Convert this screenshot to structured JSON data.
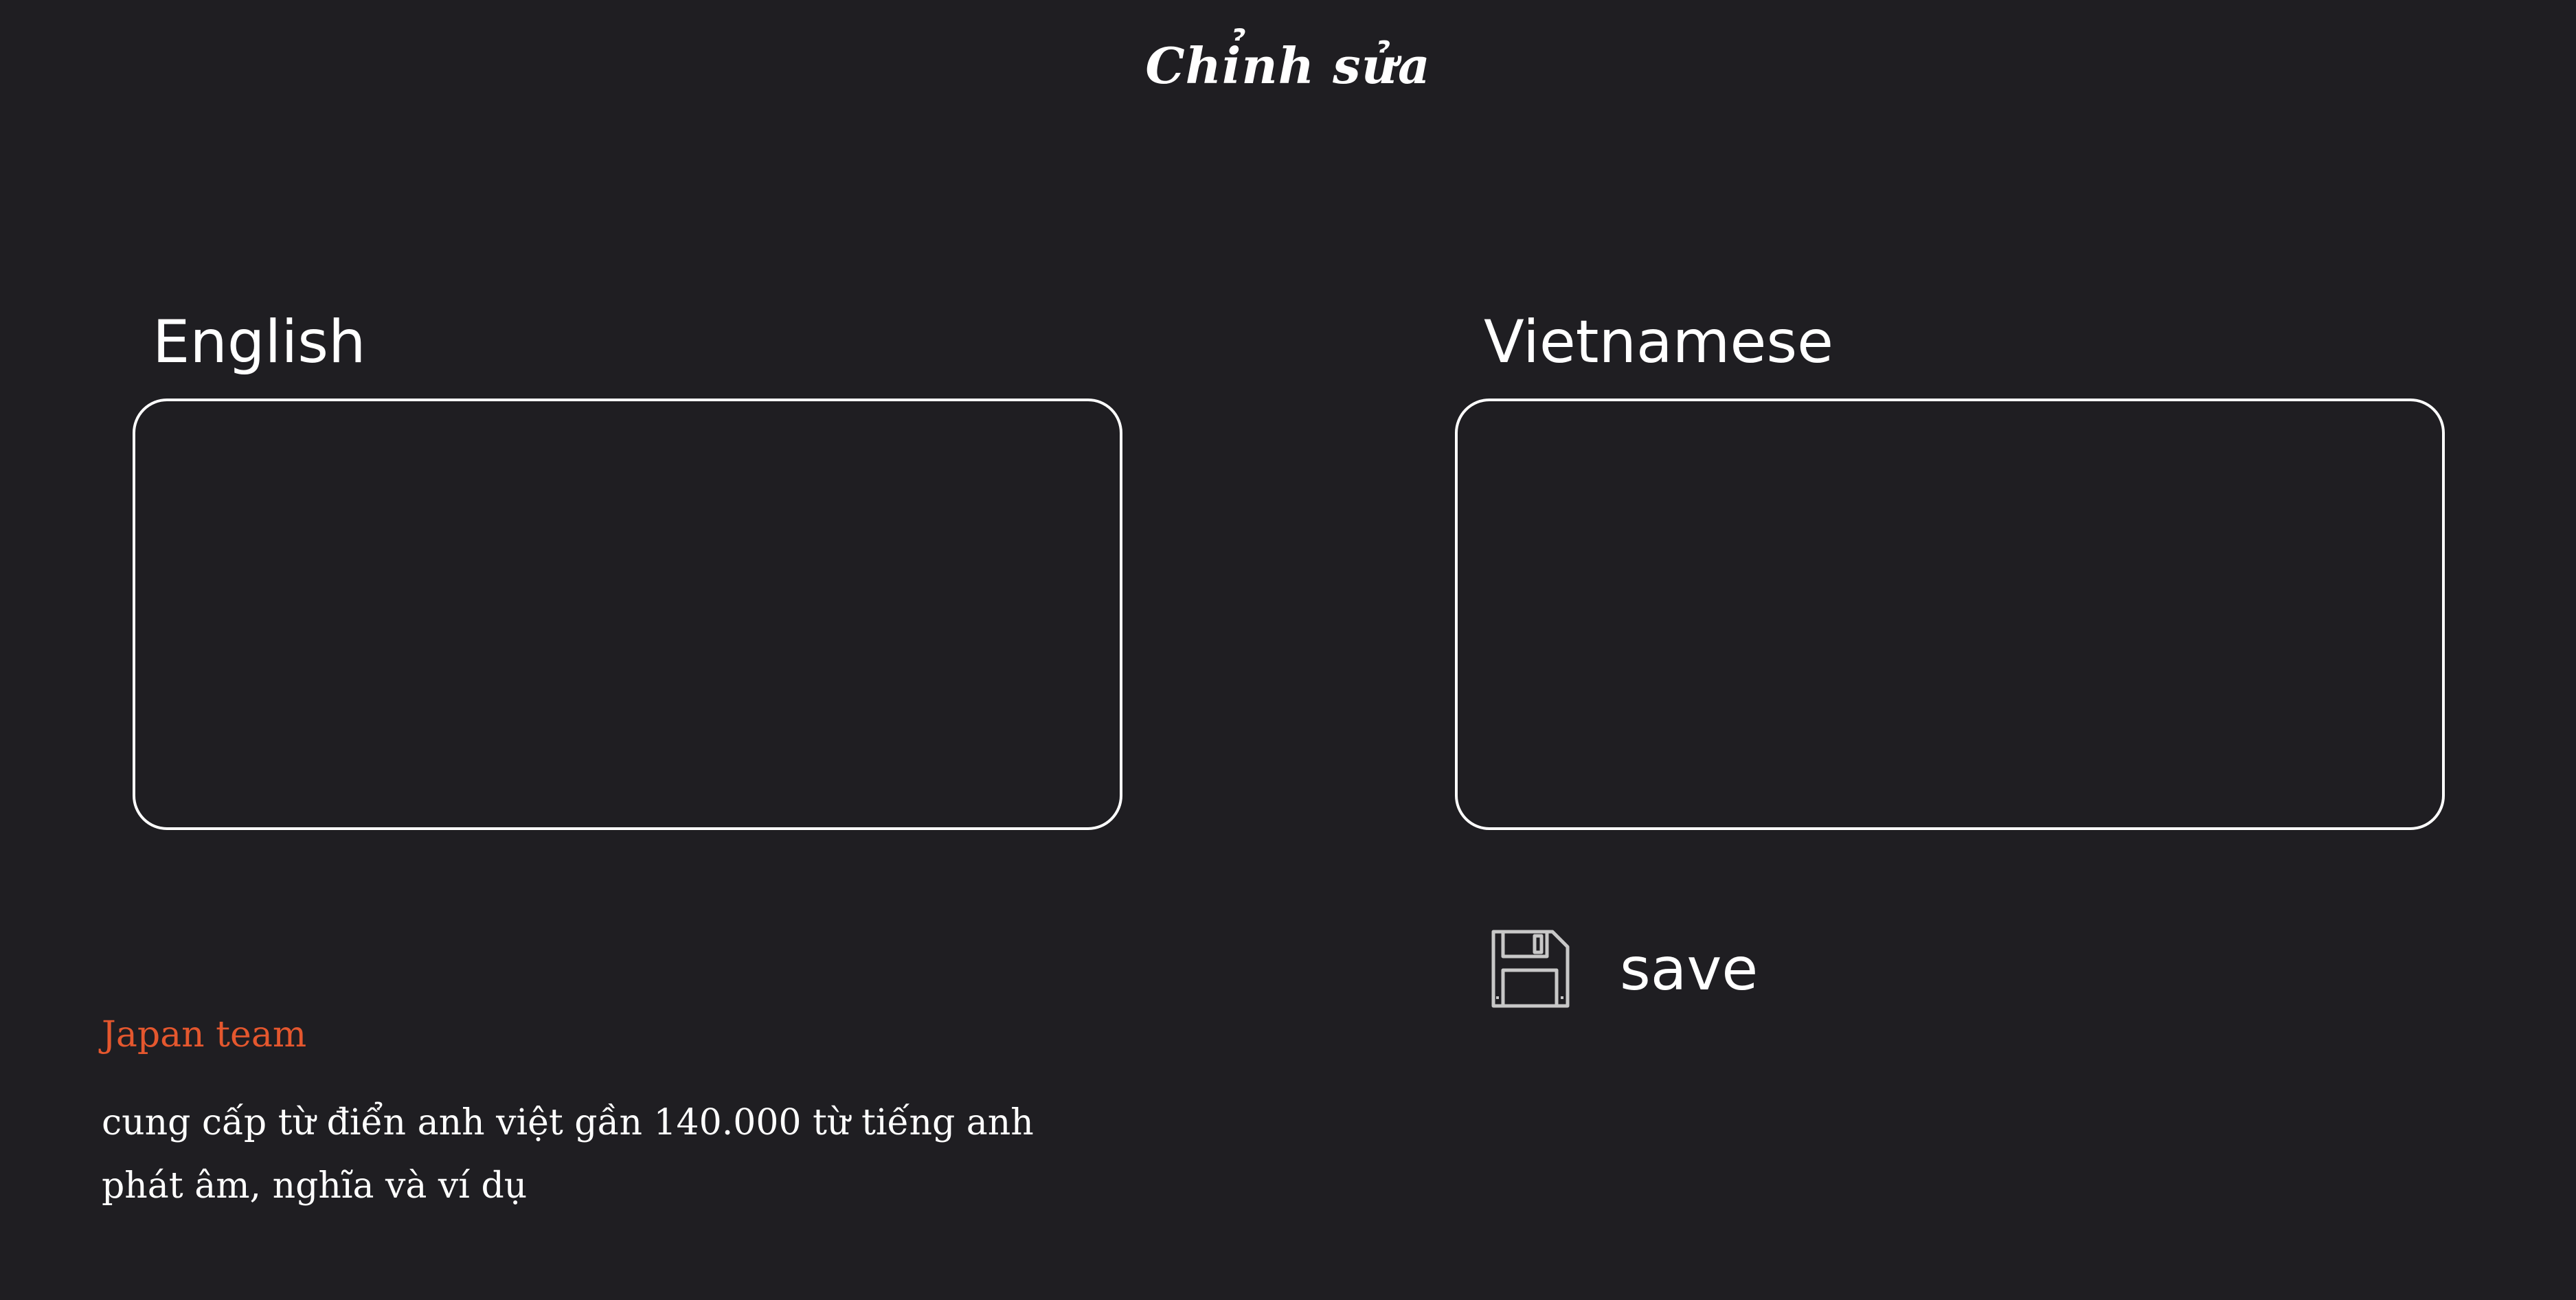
{
  "header": {
    "title": "Chỉnh sửa"
  },
  "editor": {
    "english": {
      "label": "English",
      "value": ""
    },
    "vietnamese": {
      "label": "Vietnamese",
      "value": ""
    }
  },
  "actions": {
    "save_label": "save",
    "save_icon": "floppy-disk-icon"
  },
  "footer": {
    "team": "Japan team",
    "description_lines": [
      "cung cấp từ điển anh việt gần 140.000 từ tiếng anh",
      "phát âm, nghĩa và ví dụ"
    ]
  },
  "colors": {
    "background": "#1f1e22",
    "text": "#ffffff",
    "accent": "#e4572e"
  }
}
